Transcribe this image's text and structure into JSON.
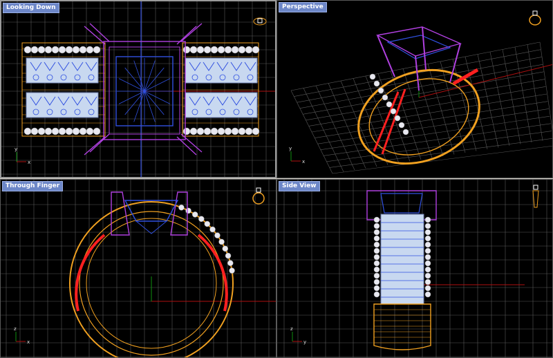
{
  "viewports": [
    {
      "id": "top",
      "title": "Looking Down"
    },
    {
      "id": "persp",
      "title": "Perspective"
    },
    {
      "id": "front",
      "title": "Through Finger"
    },
    {
      "id": "side",
      "title": "Side View"
    }
  ],
  "axes": {
    "x": "x",
    "y": "y",
    "z": "z"
  },
  "colors": {
    "background": "#000000",
    "grid": "#5a5a5a",
    "grid_major": "#8a8a8a",
    "axis_x": "#b01010",
    "axis_y": "#109010",
    "gold_wire": "#f0a020",
    "gems": "#c8d8f0",
    "prongs": "#b040e0",
    "center_stone": "#3050e0",
    "highlight": "#ff2020",
    "title_bg": "#6d87c8"
  }
}
